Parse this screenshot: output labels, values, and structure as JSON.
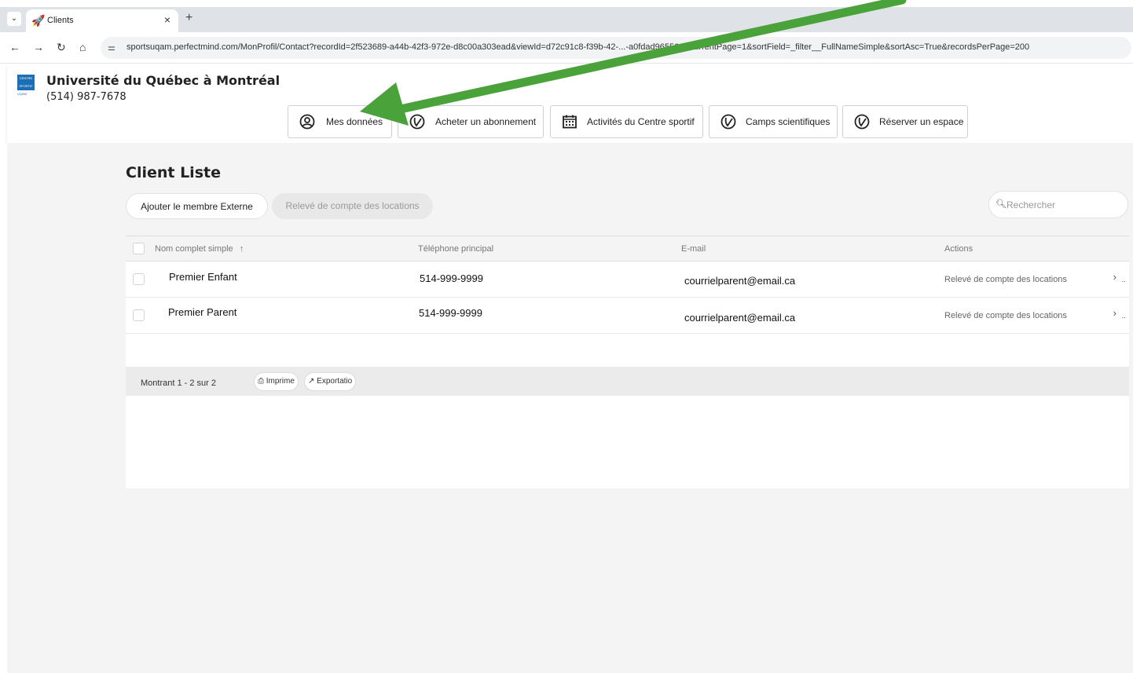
{
  "browser": {
    "tab_title": "Clients",
    "tab_close": "×",
    "new_tab": "+",
    "url": "sportsuqam.perfectmind.com/MonProfil/Contact?recordId=2f523689-a44b-42f3-972e-d8c00a303ead&viewId=d72c91c8-f39b-42-...-a0fdad965562&currentPage=1&sortField=_filter__FullNameSimple&sortAsc=True&recordsPerPage=200"
  },
  "header": {
    "org_name": "Université du Québec à Montréal",
    "phone": "(514) 987-7678",
    "logo_text": "CENTRE SPORTIF",
    "logo_sub": "UQÀM",
    "nav": [
      {
        "label": "Mes données",
        "icon": "user-circle-icon"
      },
      {
        "label": "Acheter un abonnement",
        "icon": "check-circle-icon"
      },
      {
        "label": "Activités du Centre sportif",
        "icon": "calendar-icon"
      },
      {
        "label": "Camps scientifiques",
        "icon": "check-circle-icon"
      },
      {
        "label": "Réserver un espace",
        "icon": "check-circle-icon"
      }
    ]
  },
  "main": {
    "title": "Client Liste",
    "add_button": "Ajouter le membre Externe",
    "statement_button": "Relevé de compte des locations",
    "search_placeholder": "Rechercher",
    "columns": [
      "Nom complet simple",
      "Téléphone principal",
      "E-mail",
      "Actions"
    ],
    "sort_indicator": "↑",
    "rows": [
      {
        "name": "Premier Enfant",
        "phone": "514-999-9999",
        "email": "courrielparent@email.ca",
        "action": "Relevé de compte des locations"
      },
      {
        "name": "Premier Parent",
        "phone": "514-999-9999",
        "email": "courrielparent@email.ca",
        "action": "Relevé de compte des locations"
      }
    ],
    "footer": {
      "count": "Montrant 1 - 2 sur 2",
      "print": "Imprime",
      "export": "Exportatio"
    }
  },
  "colors": {
    "annotation_arrow": "#4aa23a",
    "logo_blue": "#1c6fb6"
  }
}
